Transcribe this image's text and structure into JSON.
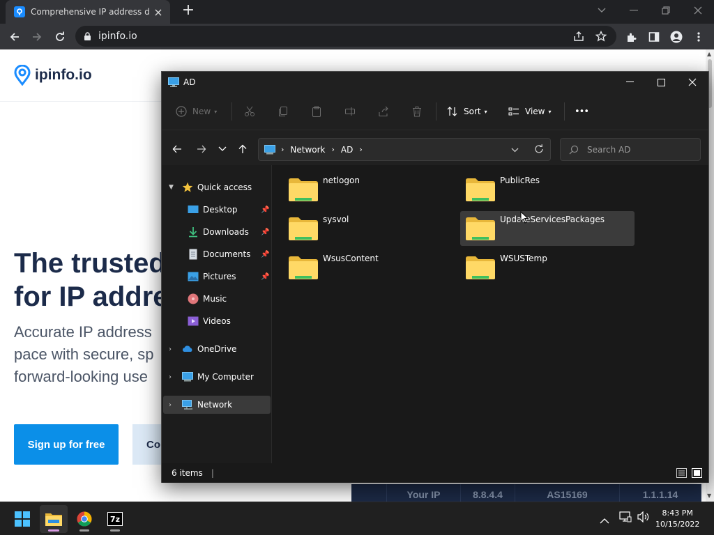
{
  "browser": {
    "tab_title": "Comprehensive IP address data, I",
    "url": "ipinfo.io"
  },
  "webpage": {
    "logo_text": "ipinfo.io",
    "hero_line1": "The trusted",
    "hero_line2": "for IP addre",
    "sub_line1": "Accurate IP address",
    "sub_line2": "pace with secure, sp",
    "sub_line3": "forward-looking use",
    "cta_primary": "Sign up for free",
    "cta_secondary": "Co",
    "ip_table": [
      "Your IP",
      "8.8.4.4",
      "AS15169",
      "1.1.1.14"
    ]
  },
  "explorer": {
    "title": "AD",
    "toolbar": {
      "new_label": "New",
      "sort_label": "Sort",
      "view_label": "View",
      "more_label": "•••"
    },
    "breadcrumb": [
      "Network",
      "AD"
    ],
    "search_placeholder": "Search AD",
    "nav": {
      "quick_access": "Quick access",
      "desktop": "Desktop",
      "downloads": "Downloads",
      "documents": "Documents",
      "pictures": "Pictures",
      "music": "Music",
      "videos": "Videos",
      "onedrive": "OneDrive",
      "my_computer": "My Computer",
      "network": "Network"
    },
    "folders": [
      "netlogon",
      "PublicRes",
      "sysvol",
      "UpdateServicesPackages",
      "WsusContent",
      "WSUSTemp"
    ],
    "status": "6 items"
  },
  "taskbar": {
    "time": "8:43 PM",
    "date": "10/15/2022",
    "sevenzip_label": "7z"
  }
}
